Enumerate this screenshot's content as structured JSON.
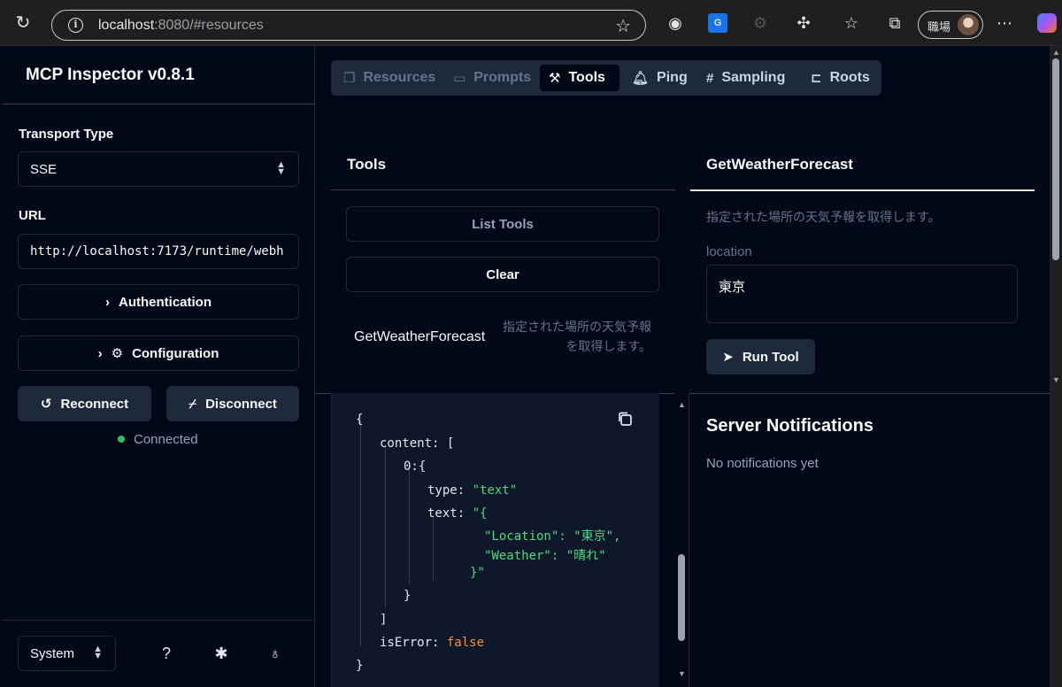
{
  "browser": {
    "url_host": "localhost",
    "url_rest": ":8080/#resources",
    "profile_name": "職場"
  },
  "sidebar": {
    "title": "MCP Inspector v0.8.1",
    "transport_label": "Transport Type",
    "transport_value": "SSE",
    "url_label": "URL",
    "url_value": "http://localhost:7173/runtime/webh",
    "auth_label": "Authentication",
    "config_label": "Configuration",
    "reconnect_label": "Reconnect",
    "disconnect_label": "Disconnect",
    "status": "Connected",
    "theme_value": "System"
  },
  "tabs": [
    {
      "label": "Resources",
      "icon": "files-icon"
    },
    {
      "label": "Prompts",
      "icon": "message-icon"
    },
    {
      "label": "Tools",
      "icon": "hammer-icon"
    },
    {
      "label": "Ping",
      "icon": "bell-icon"
    },
    {
      "label": "Sampling",
      "icon": "hash-icon"
    },
    {
      "label": "Roots",
      "icon": "tree-icon"
    }
  ],
  "tools_panel": {
    "title": "Tools",
    "list_label": "List Tools",
    "clear_label": "Clear",
    "tool_name": "GetWeatherForecast",
    "tool_desc": "指定された場所の天気予報を取得します。"
  },
  "tool_detail": {
    "title": "GetWeatherForecast",
    "description": "指定された場所の天気予報を取得します。",
    "param_label": "location",
    "param_value": "東京",
    "run_label": "Run Tool"
  },
  "result": {
    "open": "{",
    "content_key": "content:",
    "content_open": "[",
    "item_key": "0:",
    "item_open": "{",
    "type_key": "type:",
    "type_val": "\"text\"",
    "text_key": "text:",
    "text_l1": "\"{",
    "text_l2": "\"Location\": \"東京\",",
    "text_l3": "\"Weather\": \"晴れ\"",
    "text_l4": "}\"",
    "item_close": "}",
    "content_close": "]",
    "err_key": "isError:",
    "err_val": "false",
    "close": "}"
  },
  "notifications": {
    "title": "Server Notifications",
    "empty": "No notifications yet"
  },
  "colors": {
    "background": "#020817",
    "surface": "#1e293b",
    "string": "#4ade80",
    "boolean": "#fb923c",
    "status_ok": "#22c55e"
  }
}
